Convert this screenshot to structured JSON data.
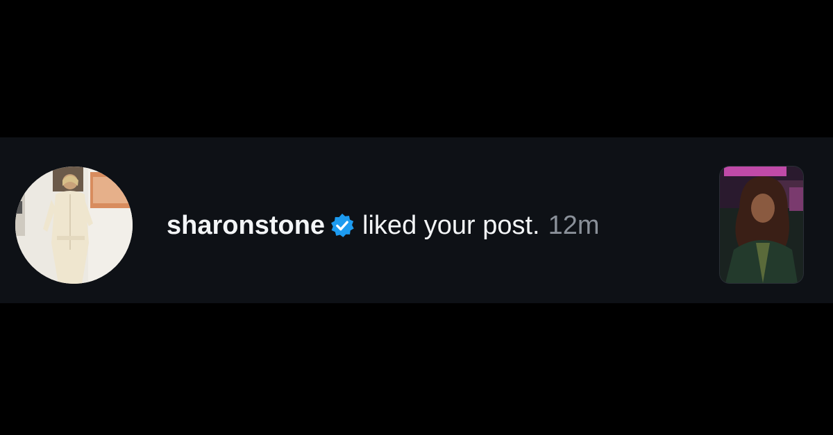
{
  "notification": {
    "username": "sharonstone",
    "verified": true,
    "verified_badge_icon": "verified-badge-icon",
    "action": "liked your post.",
    "time_ago": "12m",
    "colors": {
      "background": "#0e1116",
      "primary_text": "#f3f5f7",
      "secondary_text": "#8a9099",
      "verified_blue": "#1d9bf0"
    }
  }
}
